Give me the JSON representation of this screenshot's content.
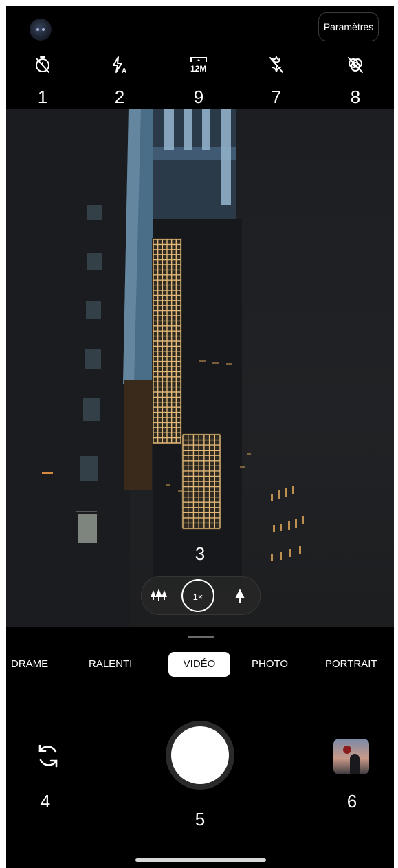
{
  "top_bar": {
    "settings_label": "Paramètres",
    "icons": [
      {
        "name": "timer-off-icon",
        "callout": "1"
      },
      {
        "name": "flash-auto-icon",
        "callout": "2"
      },
      {
        "name": "resolution-12m-icon",
        "callout": "9",
        "text": "12M"
      },
      {
        "name": "macro-off-icon",
        "callout": "7"
      },
      {
        "name": "filter-off-icon",
        "callout": "8"
      }
    ]
  },
  "viewfinder": {
    "zoom_callout": "3",
    "zoom_level": "1×"
  },
  "modes": [
    "DRAME",
    "RALENTI",
    "VIDÉO",
    "PHOTO",
    "PORTRAIT"
  ],
  "active_mode": "VIDÉO",
  "controls": {
    "flip_callout": "4",
    "shutter_callout": "5",
    "gallery_callout": "6"
  },
  "colors": {
    "background": "#000000",
    "accent": "#ffffff",
    "window_glow": "#d9a35a"
  }
}
